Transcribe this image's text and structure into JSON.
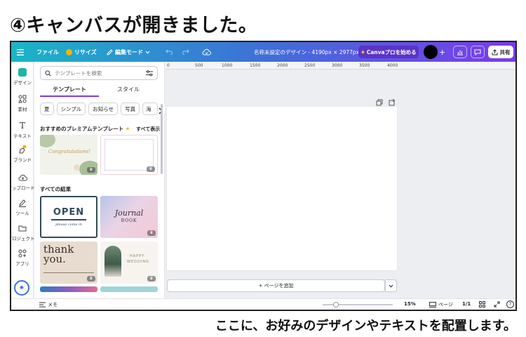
{
  "heading": "④キャンバスが開きました。",
  "caption": "ここに、お好みのデザインやテキストを配置します。",
  "topbar": {
    "menu_icon": "hamburger-icon",
    "file": "ファイル",
    "resize": "リサイズ",
    "edit_mode": "編集モード",
    "title": "名称未設定のデザイン - 4190px × 2977px",
    "canva_pro": "Canvaプロを始める",
    "share": "共有",
    "colors": {
      "gradient_start": "#19b6c7",
      "gradient_mid": "#3f6fd8",
      "gradient_end": "#7c3aed",
      "pro_button": "#5b34c9"
    }
  },
  "rail": {
    "items": [
      {
        "label": "デザイン",
        "icon": "design-icon"
      },
      {
        "label": "素材",
        "icon": "elements-icon"
      },
      {
        "label": "テキスト",
        "icon": "text-icon"
      },
      {
        "label": "ブランド",
        "icon": "brand-icon"
      },
      {
        "label": "アップロード",
        "icon": "upload-icon"
      },
      {
        "label": "ツール",
        "icon": "draw-icon"
      },
      {
        "label": "プロジェクト",
        "icon": "folder-icon"
      },
      {
        "label": "アプリ",
        "icon": "apps-icon"
      }
    ]
  },
  "panel": {
    "search_placeholder": "テンプレートを検索",
    "tabs": [
      {
        "label": "テンプレート",
        "active": true
      },
      {
        "label": "スタイル",
        "active": false
      }
    ],
    "chips": [
      "夏",
      "シンプル",
      "お知らせ",
      "写真",
      "海"
    ],
    "premium_title": "おすすめのプレミアムテンプレート",
    "see_all": "すべて表示",
    "results_title": "すべての結果",
    "template_texts": {
      "congrats": "Congratulations!",
      "open": "OPEN",
      "open_sub": "please come in",
      "journal": "Journal",
      "journal_sub": "BOOK",
      "thankyou": "thank you.",
      "wedding1": "HAPPY",
      "wedding2": "WEDDING"
    }
  },
  "ruler": [
    "0",
    "500",
    "1000",
    "1500",
    "2000",
    "2500",
    "3000",
    "3500",
    "4000"
  ],
  "canvas": {
    "add_page": "+ ページを追加"
  },
  "bottombar": {
    "notes": "メモ",
    "zoom": "15%",
    "zoom_level": 0.15,
    "pages": "ページ",
    "page_count": "1/1"
  }
}
